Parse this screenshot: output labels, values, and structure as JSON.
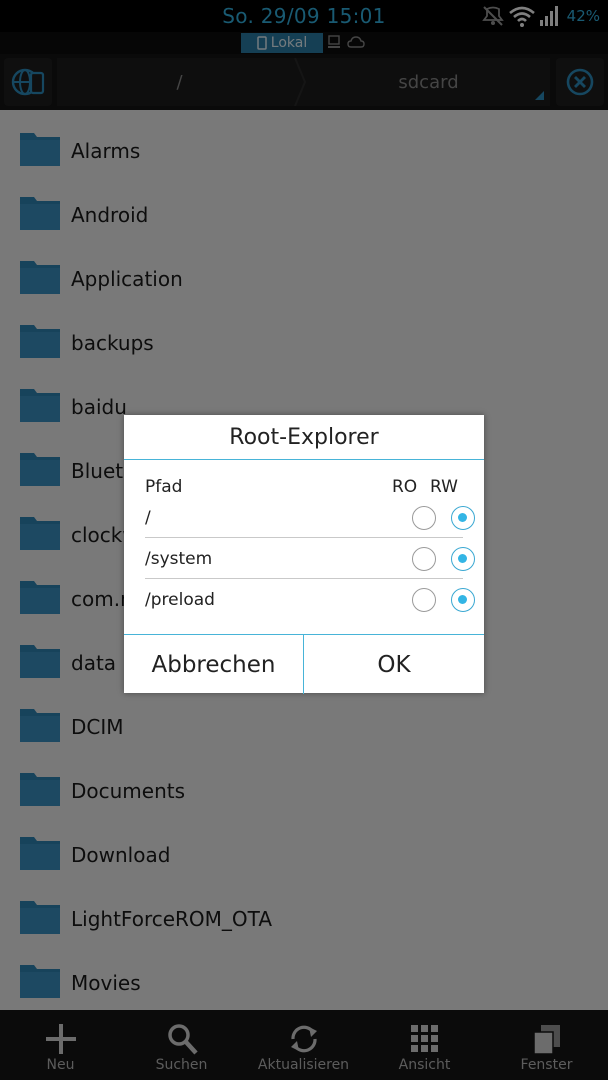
{
  "status_bar": {
    "time": "So. 29/09 15:01",
    "battery": "42%"
  },
  "location_bar": {
    "active_label": "Lokal"
  },
  "toolbar": {
    "crumbs": [
      {
        "label": "/"
      },
      {
        "label": "sdcard"
      }
    ]
  },
  "file_list": {
    "items": [
      {
        "name": "Alarms"
      },
      {
        "name": "Android"
      },
      {
        "name": "Application"
      },
      {
        "name": "backups"
      },
      {
        "name": "baidu"
      },
      {
        "name": "Bluetooth"
      },
      {
        "name": "clockworkmod"
      },
      {
        "name": "com.motorola"
      },
      {
        "name": "data"
      },
      {
        "name": "DCIM"
      },
      {
        "name": "Documents"
      },
      {
        "name": "Download"
      },
      {
        "name": "LightForceROM_OTA"
      },
      {
        "name": "Movies"
      }
    ]
  },
  "bottom_bar": {
    "items": [
      {
        "label": "Neu",
        "icon": "plus-icon"
      },
      {
        "label": "Suchen",
        "icon": "search-icon"
      },
      {
        "label": "Aktualisieren",
        "icon": "refresh-icon"
      },
      {
        "label": "Ansicht",
        "icon": "grid-icon"
      },
      {
        "label": "Fenster",
        "icon": "windows-icon"
      }
    ]
  },
  "dialog": {
    "title": "Root-Explorer",
    "header": {
      "path": "Pfad",
      "ro": "RO",
      "rw": "RW"
    },
    "rows": [
      {
        "path": "/",
        "mode": "RW"
      },
      {
        "path": "/system",
        "mode": "RW"
      },
      {
        "path": "/preload",
        "mode": "RW"
      }
    ],
    "cancel_label": "Abbrechen",
    "ok_label": "OK"
  },
  "colors": {
    "accent": "#33b5e5",
    "folder": "#2f86b6",
    "list_bg": "#f3f3f3"
  }
}
